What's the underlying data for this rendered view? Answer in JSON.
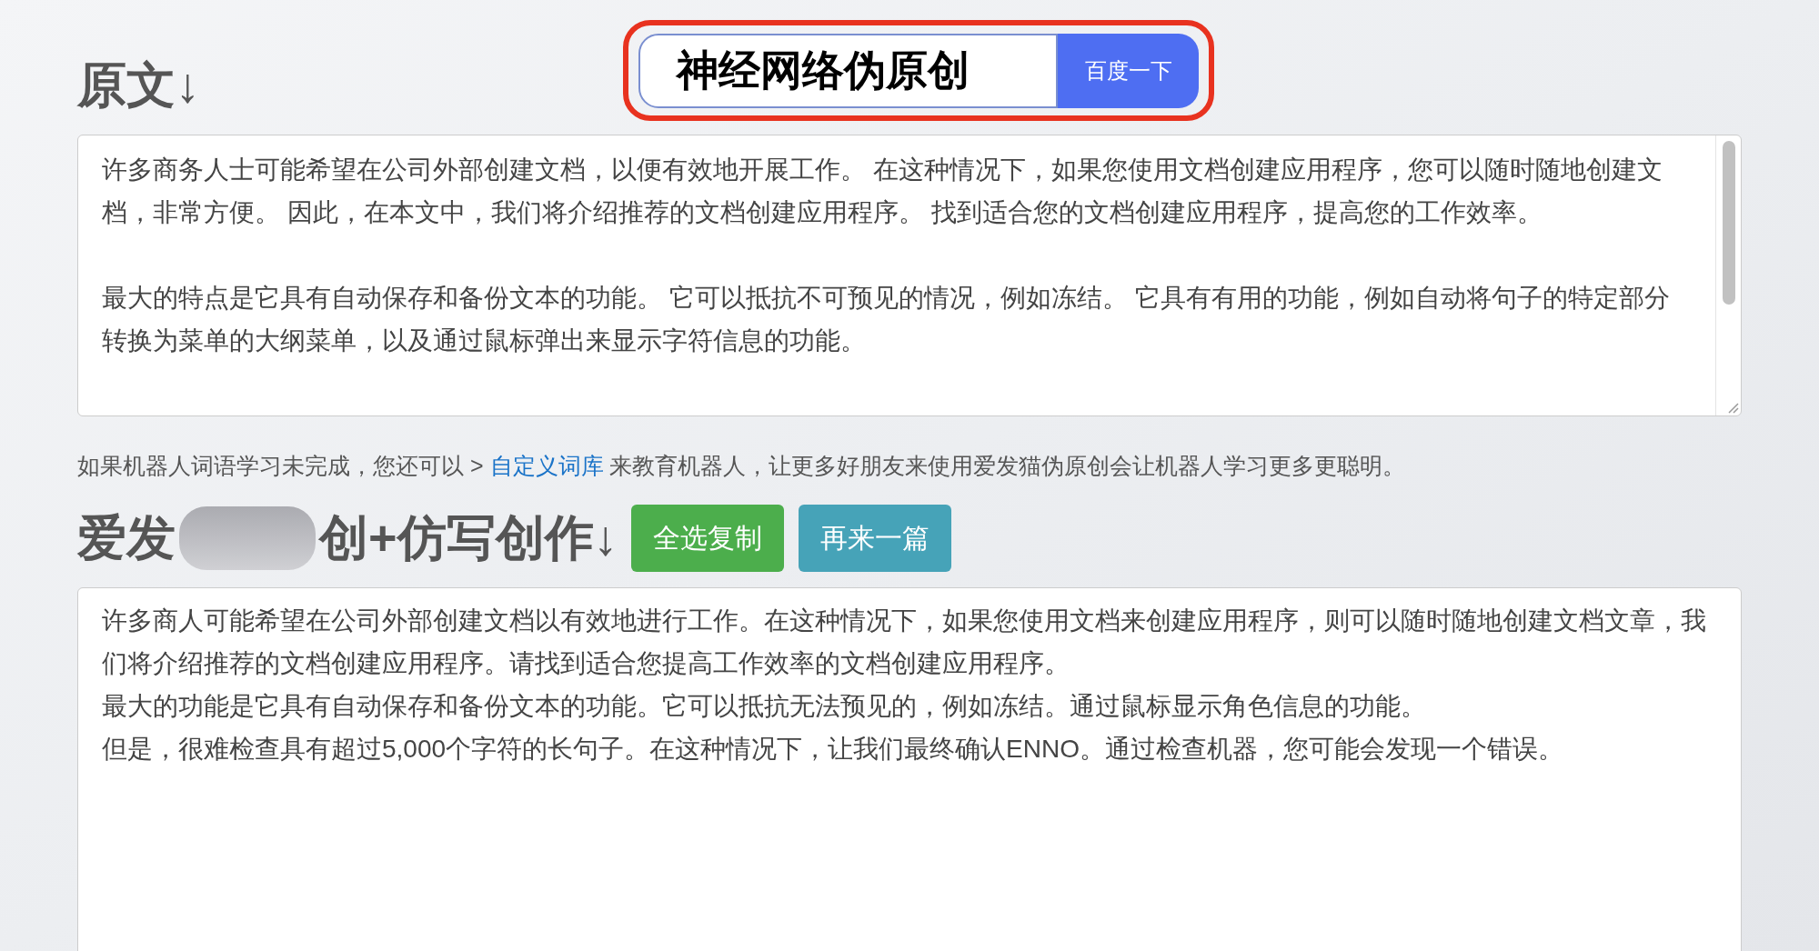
{
  "search": {
    "value": "神经网络伪原创",
    "button": "百度一下",
    "highlighted": true
  },
  "source": {
    "heading": "原文↓",
    "paragraphs": [
      "许多商务人士可能希望在公司外部创建文档，以便有效地开展工作。 在这种情况下，如果您使用文档创建应用程序，您可以随时随地创建文档，非常方便。 因此，在本文中，我们将介绍推荐的文档创建应用程序。 找到适合您的文档创建应用程序，提高您的工作效率。",
      "最大的特点是它具有自动保存和备份文本的功能。 它可以抵抗不可预见的情况，例如冻结。 它具有有用的功能，例如自动将句子的特定部分转换为菜单的大纲菜单，以及通过鼠标弹出来显示字符信息的功能。"
    ]
  },
  "hint": {
    "before": "如果机器人词语学习未完成，您还可以 > ",
    "link": "自定义词库",
    "after": " 来教育机器人，让更多好朋友来使用爱发猫伪原创会让机器人学习更多更聪明。"
  },
  "result": {
    "heading_start": "爱发",
    "heading_end": "创+仿写创作↓",
    "buttons": [
      {
        "label": "全选复制",
        "kind": "success"
      },
      {
        "label": "再来一篇",
        "kind": "info"
      }
    ],
    "lines": [
      "许多商人可能希望在公司外部创建文档以有效地进行工作。在这种情况下，如果您使用文档来创建应用程序，则可以随时随地创建文档文章，我们将介绍推荐的文档创建应用程序。请找到适合您提高工作效率的文档创建应用程序。",
      "最大的功能是它具有自动保存和备份文本的功能。它可以抵抗无法预见的，例如冻结。通过鼠标显示角色信息的功能。",
      "但是，很难检查具有超过5,000个字符的长句子。在这种情况下，让我们最终确认ENNO。通过检查机器，您可能会发现一个错误。"
    ]
  }
}
